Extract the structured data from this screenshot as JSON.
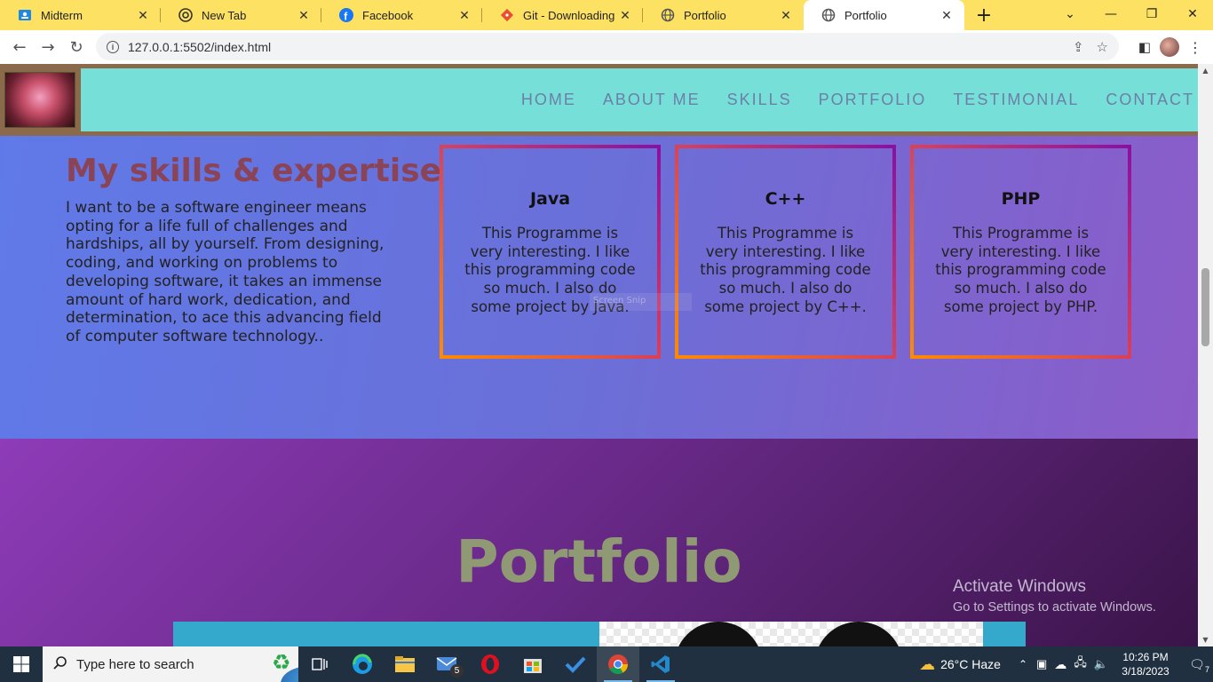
{
  "browser": {
    "tabs": [
      {
        "title": "Midterm",
        "icon": "classroom-icon",
        "active": false
      },
      {
        "title": "New Tab",
        "icon": "chrome-icon",
        "active": false
      },
      {
        "title": "Facebook",
        "icon": "facebook-icon",
        "active": false
      },
      {
        "title": "Git - Downloading Pac",
        "icon": "git-icon",
        "active": false
      },
      {
        "title": "Portfolio",
        "icon": "globe-icon",
        "active": false
      },
      {
        "title": "Portfolio",
        "icon": "globe-icon",
        "active": true
      }
    ],
    "url": "127.0.0.1:5502/index.html"
  },
  "site": {
    "nav": [
      "HOME",
      "ABOUT ME",
      "SKILLS",
      "PORTFOLIO",
      "TESTIMONIAL",
      "CONTACT"
    ],
    "skills": {
      "title": "My skills & expertise",
      "description": "I want to be a software engineer means opting for a life full of challenges and hardships, all by yourself. From designing, coding, and working on problems to developing software, it takes an immense amount of hard work, dedication, and determination, to ace this advancing field of computer software technology..",
      "cards": [
        {
          "name": "Java",
          "text": "This Programme is very interesting. I like this programming code so much. I also do some project by Java."
        },
        {
          "name": "C++",
          "text": "This Programme is very interesting. I like this programming code so much. I also do some project by C++."
        },
        {
          "name": "PHP",
          "text": "This Programme is very interesting. I like this programming code so much. I also do some project by PHP."
        }
      ]
    },
    "portfolio": {
      "title": "Portfolio"
    }
  },
  "overlay": {
    "snip_label": "Screen Snip",
    "activate_title": "Activate Windows",
    "activate_sub": "Go to Settings to activate Windows."
  },
  "taskbar": {
    "search_placeholder": "Type here to search",
    "mail_badge": "5",
    "weather": "26°C  Haze",
    "time": "10:26 PM",
    "date": "3/18/2023",
    "notifications": "7"
  }
}
